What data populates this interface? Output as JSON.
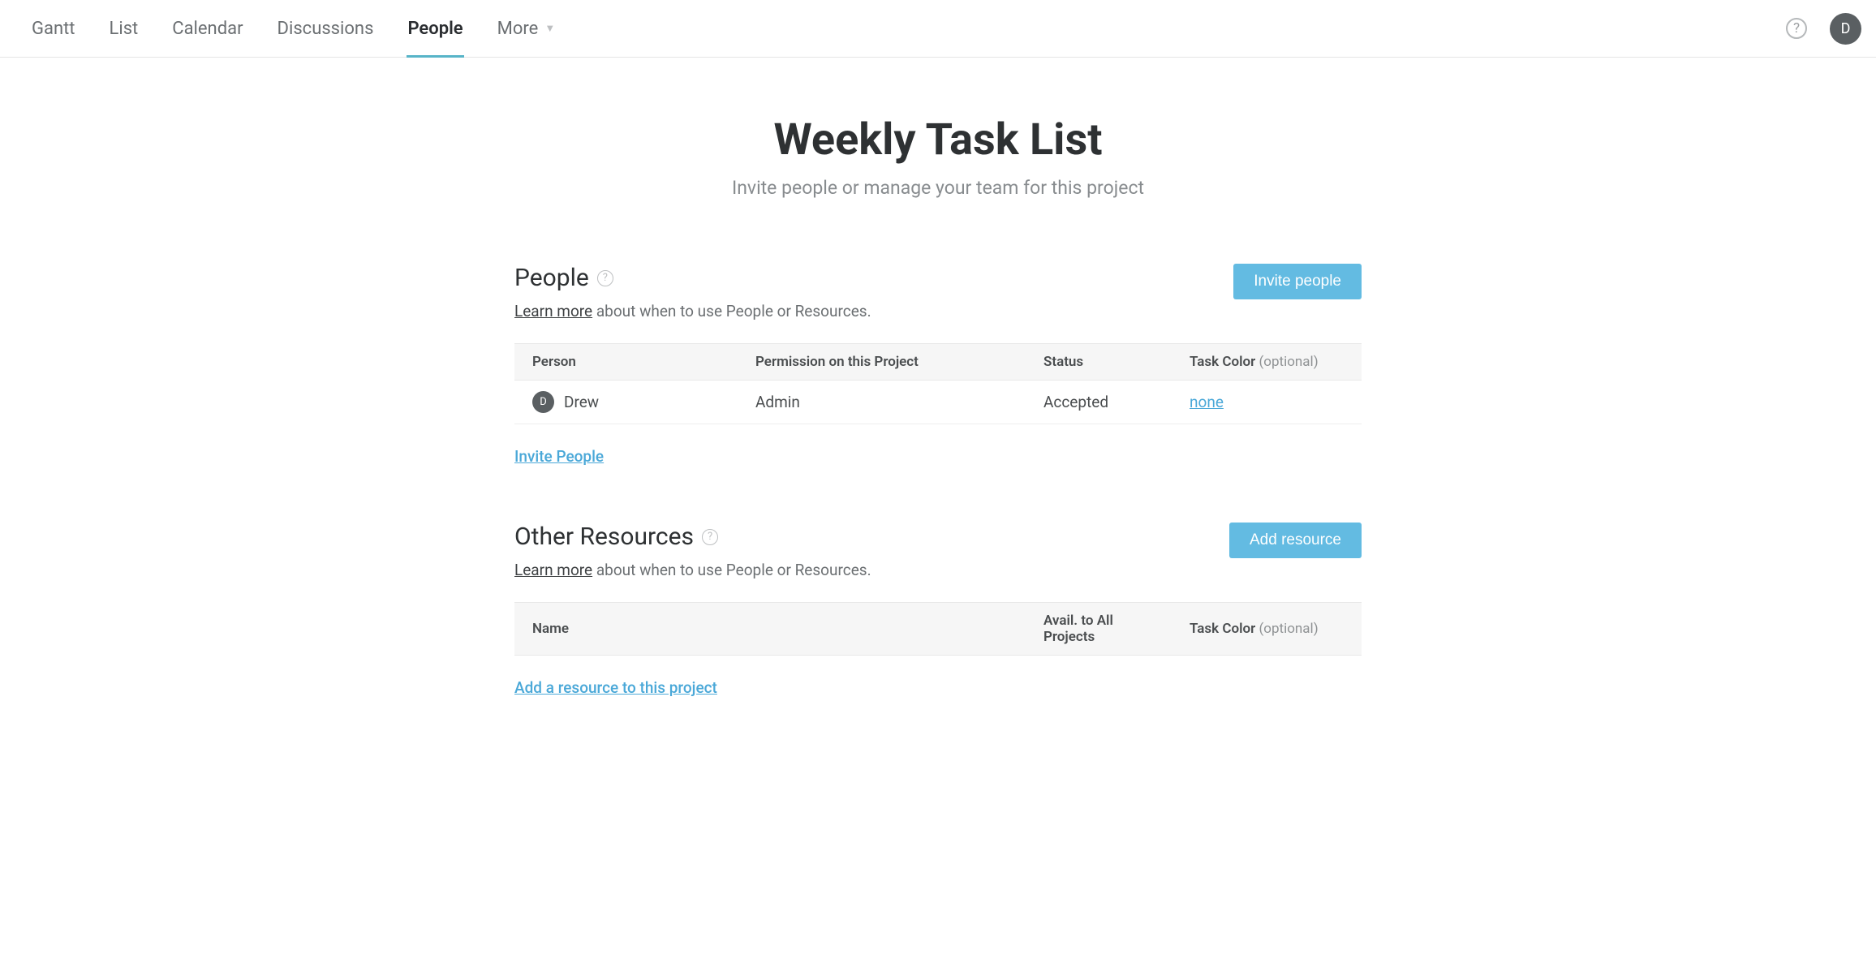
{
  "nav": {
    "items": [
      {
        "label": "Gantt",
        "active": false
      },
      {
        "label": "List",
        "active": false
      },
      {
        "label": "Calendar",
        "active": false
      },
      {
        "label": "Discussions",
        "active": false
      },
      {
        "label": "People",
        "active": true
      },
      {
        "label": "More",
        "active": false,
        "dropdown": true
      }
    ]
  },
  "header": {
    "avatar_initial": "D"
  },
  "page": {
    "title": "Weekly Task List",
    "subtitle": "Invite people or manage your team for this project"
  },
  "people_section": {
    "title": "People",
    "learn_more": "Learn more",
    "desc_rest": " about when to use People or Resources.",
    "button": "Invite people",
    "columns": {
      "person": "Person",
      "permission": "Permission on this Project",
      "status": "Status",
      "task_color": "Task Color",
      "optional": "(optional)"
    },
    "rows": [
      {
        "avatar_initial": "D",
        "name": "Drew",
        "permission": "Admin",
        "status": "Accepted",
        "task_color": "none"
      }
    ],
    "footer_link": "Invite People"
  },
  "resources_section": {
    "title": "Other Resources",
    "learn_more": "Learn more",
    "desc_rest": " about when to use People or Resources.",
    "button": "Add resource",
    "columns": {
      "name": "Name",
      "avail": "Avail. to All Projects",
      "task_color": "Task Color",
      "optional": "(optional)"
    },
    "footer_link": "Add a resource to this project"
  }
}
